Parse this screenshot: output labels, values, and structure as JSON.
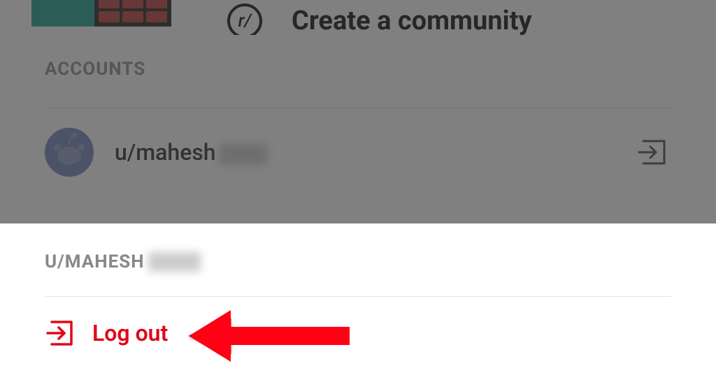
{
  "background": {
    "community_icon_label": "r/",
    "create_community_label": "Create a community"
  },
  "accounts_sheet": {
    "header": "ACCOUNTS",
    "items": [
      {
        "username_prefix": "u/mahesh"
      }
    ]
  },
  "logout_sheet": {
    "header_prefix": "U/MAHESH",
    "logout_label": "Log out"
  },
  "colors": {
    "accent_red": "#e3061a",
    "text_gray": "#888888"
  }
}
